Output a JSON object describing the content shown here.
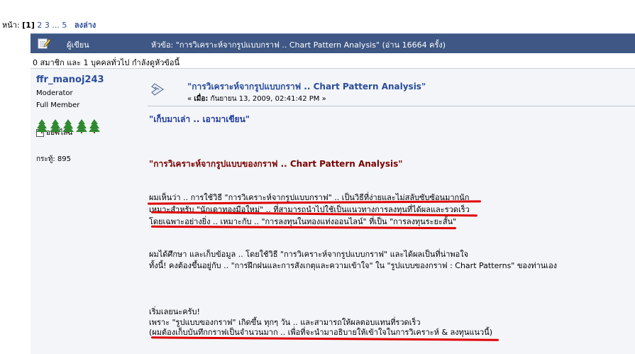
{
  "pager": {
    "prefix": "หน้า:",
    "current": "[1]",
    "pages": [
      "2",
      "3",
      "...",
      "5"
    ],
    "bottom_link": "ลงล่าง"
  },
  "header": {
    "author_label": "ผู้เขียน",
    "topic_text": "หัวข้อ: \"การวิเคราะห์จากรูปแบบกราฟ .. Chart Pattern Analysis\"  (อ่าน 16664 ครั้ง)"
  },
  "viewers": {
    "text": "0 สมาชิก และ 1 บุคคลทั่วไป กำลังดูหัวข้อนี้"
  },
  "poster": {
    "name": "ffr_manoj243",
    "role": "Moderator",
    "rank": "Full Member",
    "status": "ออฟไลน์",
    "posts": "กระทู้: 895"
  },
  "post": {
    "title": "\"การวิเคราะห์จากรูปแบบกราฟ .. Chart Pattern Analysis\"",
    "date_label": "เมื่อ:",
    "date_value": "กันยายน 13, 2009, 02:41:42 PM",
    "date_prefix": "«",
    "date_suffix": "»",
    "intro": "\"เก็บมาเล่า .. เอามาเขียน\"",
    "heading": "\"การวิเคราะห์จากรูปแบบของกราฟ .. Chart Pattern Analysis\"",
    "para1": [
      "ผมเห็นว่า .. การใช้วิธี \"การวิเคราะห์จากรูปแบบกราฟ\" .. เป็นวิธีที่ง่ายและไม่สลับซับซ้อนมากนัก",
      "เหมาะสำหรับ \"นักเดาทองมือใหม่\" .. ที่สามารถนำไปใช้เป็นแนวทางการลงทุนที่ได้ผลและรวดเร็ว",
      "โดยเฉพาะอย่างยิ่ง .. เหมาะกับ .. \"การลงทุนในทองแท่งออนไลน์\" ที่เป็น \"การลงทุนระยะสั้น\""
    ],
    "para2": [
      "ผมได้ศึกษา และเก็บข้อมูล .. โดยใช้วิธี \"การวิเคราะห์จากรูปแบบกราฟ\" และได้ผลเป็นที่น่าพอใจ",
      "ทั้งนี้!  คงต้องขึ้นอยู่กับ .. \"การฝึกฝนและการสังเกตุและความเข้าใจ\" ใน \"รูปแบบของกราฟ : Chart Patterns\" ของท่านเอง"
    ],
    "para3": [
      "เริ่มเลยนะครับ!",
      "เพราะ \"รูปแบบของกราฟ\" เกิดขึ้น ทุกๆ วัน .. และสามารถให้ผลตอบแทนที่รวดเร็ว",
      "(ผมต้องเก็บบันทึกกราฟเป็นจำนวนมาก .. เพื่อที่จะนำมาอธิบายให้เข้าใจในการวิเคราะห์ & ลงทุนแนวนี้)"
    ]
  },
  "colors": {
    "header_bg": "#3e5784",
    "link_blue": "#2a4c9b",
    "highlight_red": "#e00000",
    "post_bg": "#f3f5f8"
  }
}
